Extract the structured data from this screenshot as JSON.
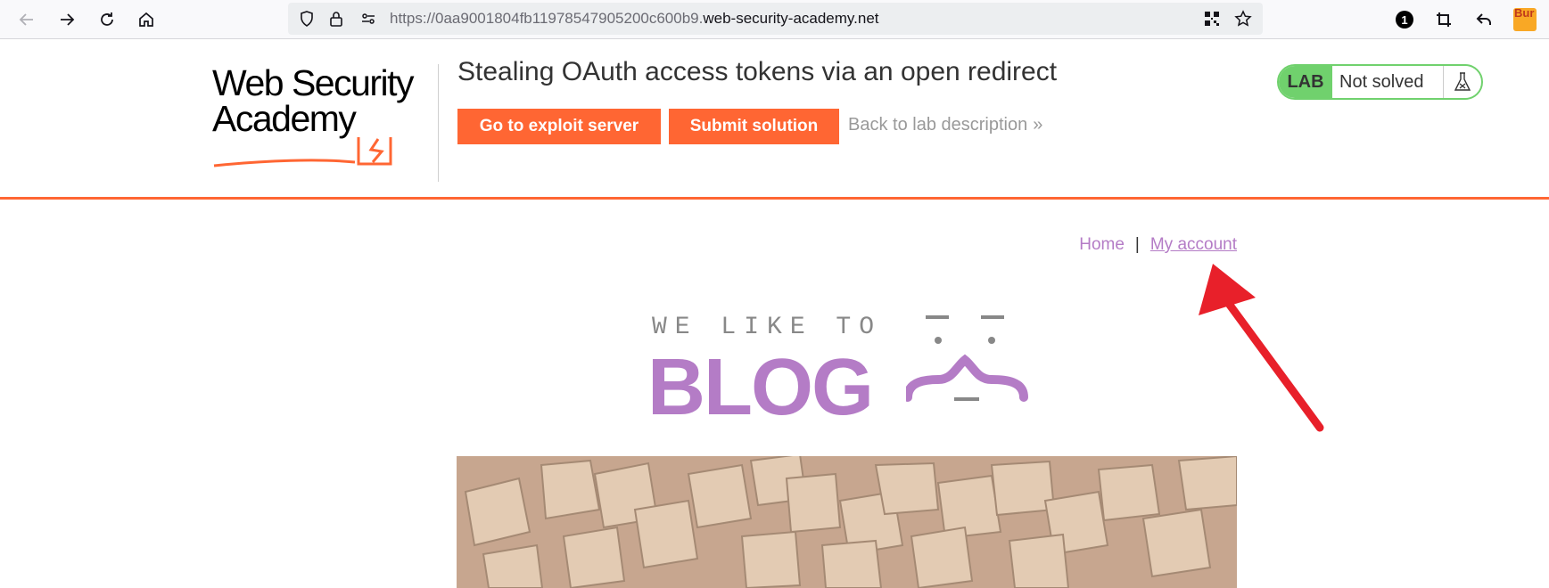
{
  "browser": {
    "url_prefix": "https://0aa9001804fb11978547905200c600b9.",
    "url_domain": "web-security-academy.net",
    "extension_badge": "1",
    "burp_label": "Bur"
  },
  "lab": {
    "logo_line1": "Web Security",
    "logo_line2": "Academy",
    "title": "Stealing OAuth access tokens via an open redirect",
    "exploit_button": "Go to exploit server",
    "submit_button": "Submit solution",
    "back_link": "Back to lab description",
    "status_badge": "LAB",
    "status_text": "Not solved"
  },
  "nav": {
    "home": "Home",
    "separator": "|",
    "my_account": "My account"
  },
  "blog": {
    "tagline": "WE LIKE TO",
    "word": "BLOG"
  },
  "colors": {
    "accent": "#ff6633",
    "link": "#b47cc6",
    "lab_green": "#70d16d",
    "annotation_arrow": "#e8202a"
  }
}
